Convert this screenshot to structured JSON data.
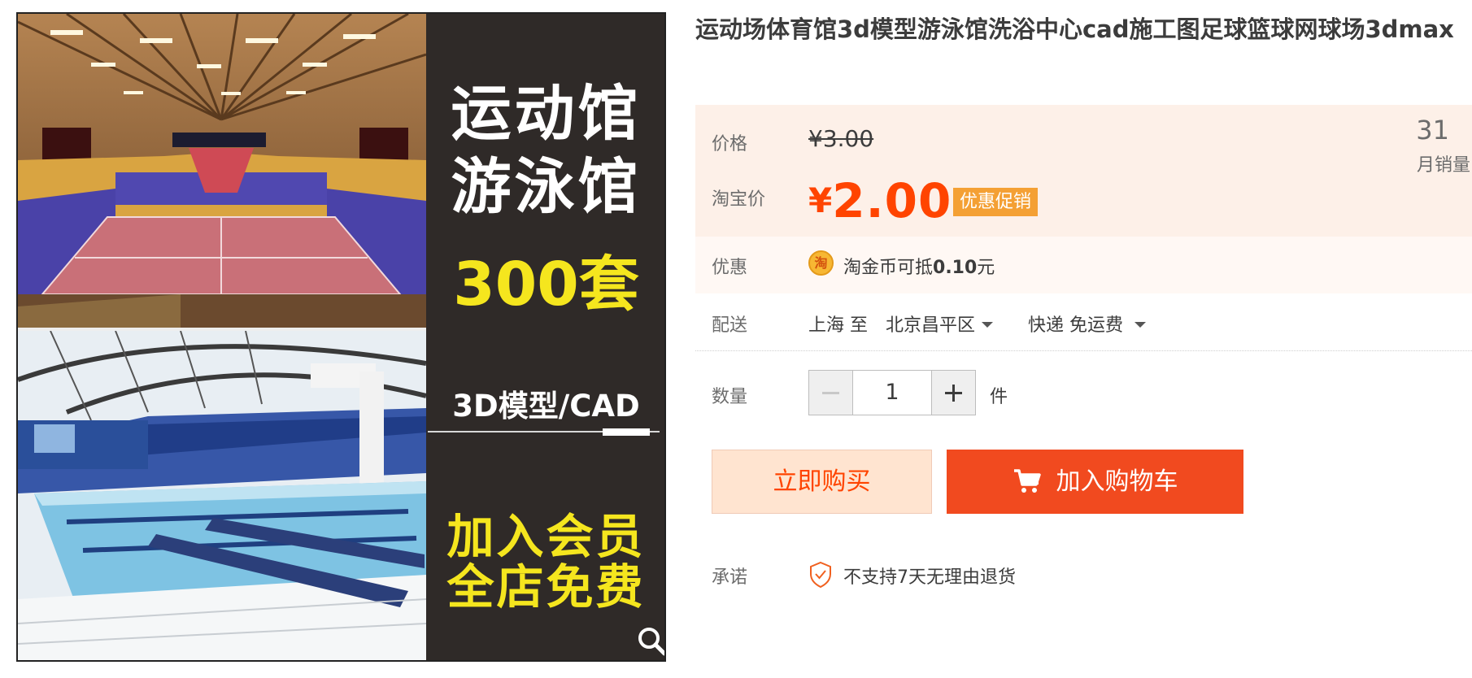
{
  "product": {
    "title": "运动场体育馆3d模型游泳馆洗浴中心cad施工图足球篮球网球场3dmax"
  },
  "gallery": {
    "line1": "运动馆",
    "line2": "游泳馆",
    "count": "300套",
    "format": "3D模型/CAD",
    "member1": "加入会员",
    "member2": "全店免费",
    "zoom_icon": "magnifier-icon"
  },
  "price": {
    "label": "价格",
    "original": "¥3.00",
    "taobao_label": "淘宝价",
    "currency": "¥",
    "value": "2.00",
    "promo_tag": "优惠促销",
    "monthly_sales": "31",
    "monthly_sales_label": "月销量"
  },
  "coupon": {
    "label": "优惠",
    "coin_icon": "淘",
    "text_prefix": "淘金币可抵",
    "amount": "0.10",
    "text_suffix": "元"
  },
  "shipping": {
    "label": "配送",
    "from": "上海 至",
    "to": "北京昌平区",
    "method": "快递 免运费"
  },
  "quantity": {
    "label": "数量",
    "value": "1",
    "unit": "件"
  },
  "actions": {
    "buy_now": "立即购买",
    "add_to_cart": "加入购物车"
  },
  "promise": {
    "label": "承诺",
    "text": "不支持7天无理由退货"
  },
  "colors": {
    "accent": "#ff4400",
    "cart_button": "#f14a1f",
    "promo_tag": "#f4a034",
    "price_box": "#fdf0e8"
  }
}
